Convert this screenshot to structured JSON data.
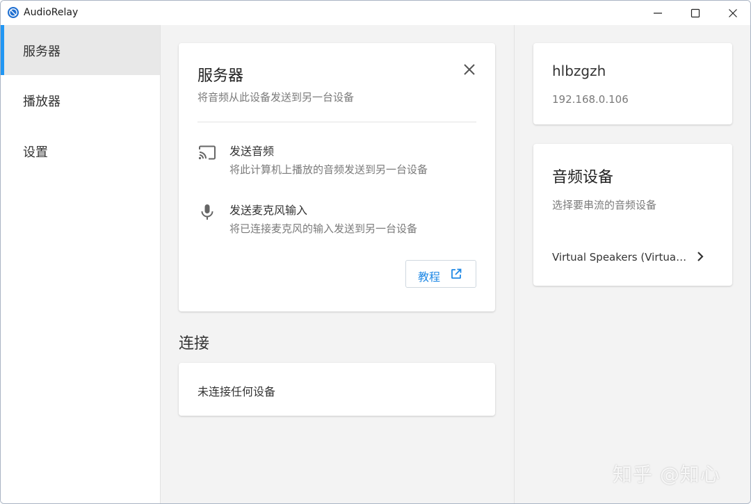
{
  "window": {
    "title": "AudioRelay",
    "controls": [
      "minimize-icon",
      "maximize-icon",
      "close-icon"
    ]
  },
  "sidebar": {
    "items": [
      {
        "label": "服务器",
        "active": true
      },
      {
        "label": "播放器",
        "active": false
      },
      {
        "label": "设置",
        "active": false
      }
    ]
  },
  "server_card": {
    "title": "服务器",
    "subtitle": "将音频从此设备发送到另一台设备",
    "features": [
      {
        "icon": "cast-icon",
        "title": "发送音频",
        "description": "将此计算机上播放的音频发送到另一台设备"
      },
      {
        "icon": "microphone-icon",
        "title": "发送麦克风输入",
        "description": "将已连接麦克风的输入发送到另一台设备"
      }
    ],
    "tutorial_label": "教程"
  },
  "connections": {
    "heading": "连接",
    "empty_text": "未连接任何设备"
  },
  "host": {
    "name": "hlbzgzh",
    "ip": "192.168.0.106"
  },
  "audio_device": {
    "title": "音频设备",
    "subtitle": "选择要串流的音频设备",
    "selected": "Virtual Speakers (Virtual Audio Device)"
  },
  "watermark": "知乎 @知心",
  "colors": {
    "accent": "#2196f3",
    "link": "#1e88e5",
    "app_icon": "#1f6fd1"
  }
}
